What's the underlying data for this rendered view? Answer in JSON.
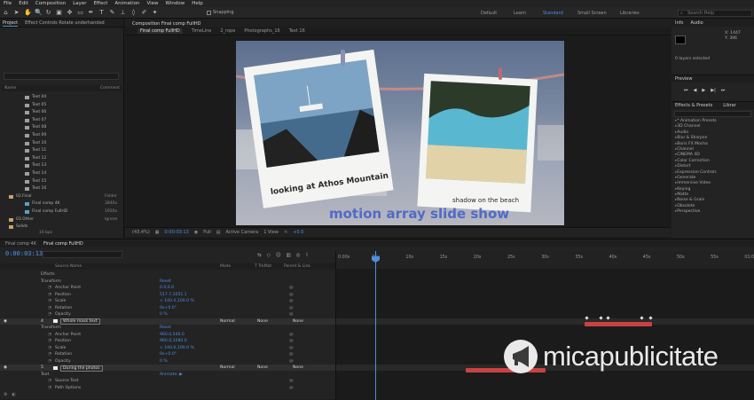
{
  "menu": [
    "File",
    "Edit",
    "Composition",
    "Layer",
    "Effect",
    "Animation",
    "View",
    "Window",
    "Help"
  ],
  "toolbar": {
    "snapping_label": "Snapping",
    "workspaces": [
      "Default",
      "Learn",
      "Standard",
      "Small Screen",
      "Libraries"
    ],
    "active_workspace": "Standard",
    "search_placeholder": "Search Help"
  },
  "project_panel": {
    "tabs": [
      "Project",
      "Effect Controls Rotate underhanded"
    ],
    "col_name": "Name",
    "col_comment": "Comment",
    "items": [
      {
        "name": "Text 04",
        "type": ""
      },
      {
        "name": "Text 05",
        "type": ""
      },
      {
        "name": "Text 06",
        "type": ""
      },
      {
        "name": "Text 07",
        "type": ""
      },
      {
        "name": "Text 08",
        "type": ""
      },
      {
        "name": "Text 09",
        "type": ""
      },
      {
        "name": "Text 10",
        "type": ""
      },
      {
        "name": "Text 11",
        "type": ""
      },
      {
        "name": "Text 12",
        "type": ""
      },
      {
        "name": "Text 13",
        "type": ""
      },
      {
        "name": "Text 14",
        "type": ""
      },
      {
        "name": "Text 15",
        "type": ""
      },
      {
        "name": "Text 16",
        "type": ""
      },
      {
        "name": "02.Final",
        "type": "Folder"
      },
      {
        "name": "Final comp 4K",
        "type": "3840x"
      },
      {
        "name": "Final comp FullHD",
        "type": "1920x"
      },
      {
        "name": "03.Other",
        "type": "Ignore"
      },
      {
        "name": "Solids",
        "type": ""
      }
    ],
    "footer_bpc": "16 bpc"
  },
  "composition": {
    "tab": "Composition Final comp FullHD",
    "breadcrumbs": [
      "Final comp FullHD",
      "TimeLine",
      "2_rope",
      "Photographs_16",
      "Text 16"
    ],
    "canvas": {
      "caption_left": "looking at Athos Mountain",
      "caption_right": "shadow on the beach",
      "title_text": "motion array slide show"
    },
    "viewer_bar": {
      "zoom": "(43.4%)",
      "timecode": "0:00:03:13",
      "resolution": "Full",
      "camera": "Active Camera",
      "views": "1 View",
      "exposure": "+0.0"
    }
  },
  "right_panel": {
    "info_tabs": [
      "Info",
      "Audio"
    ],
    "info_values": [
      "X: 1447",
      "Y: 396"
    ],
    "layers_selected": "0 layers selected",
    "preview_label": "Preview",
    "effects_label": "Effects & Presets",
    "effects_tab2": "Librar",
    "effects_search": "",
    "effects": [
      "* Animation Presets",
      "3D Channel",
      "Audio",
      "Blur & Sharpen",
      "Boris FX Mocha",
      "Channel",
      "CINEMA 4D",
      "Color Correction",
      "Distort",
      "Expression Controls",
      "Generate",
      "Immersive Video",
      "Keying",
      "Matte",
      "Noise & Grain",
      "Obsolete",
      "Perspective"
    ]
  },
  "timeline": {
    "tabs": [
      "Final comp 4K",
      "Final comp FullHD"
    ],
    "active_tab": "Final comp FullHD",
    "timecode": "0:00:03:13",
    "columns": [
      "Source Name",
      "Mode",
      "T TrkMat",
      "Parent & Link"
    ],
    "rows": [
      {
        "kind": "prop",
        "indent": 2,
        "label": "Effects",
        "value": ""
      },
      {
        "kind": "prop",
        "indent": 2,
        "label": "Transform",
        "value": "Reset"
      },
      {
        "kind": "prop",
        "indent": 3,
        "label": "Anchor Point",
        "value": "0.0,0.0"
      },
      {
        "kind": "prop",
        "indent": 3,
        "label": "Position",
        "value": "517.7,1051.1"
      },
      {
        "kind": "prop",
        "indent": 3,
        "label": "Scale",
        "value": "∞ 100.0,100.0 %"
      },
      {
        "kind": "prop",
        "indent": 3,
        "label": "Rotation",
        "value": "0x+0.0°"
      },
      {
        "kind": "prop",
        "indent": 3,
        "label": "Opacity",
        "value": "0 %"
      },
      {
        "kind": "layer",
        "index": "4",
        "label": "Whole mask text",
        "mode": "Normal",
        "trkmat": "None",
        "parent": "None"
      },
      {
        "kind": "prop",
        "indent": 2,
        "label": "Transform",
        "value": "Reset"
      },
      {
        "kind": "prop",
        "indent": 3,
        "label": "Anchor Point",
        "value": "960.0,540.0"
      },
      {
        "kind": "prop",
        "indent": 3,
        "label": "Position",
        "value": "960.0,1080.0"
      },
      {
        "kind": "prop",
        "indent": 3,
        "label": "Scale",
        "value": "∞ 100.0,100.0 %"
      },
      {
        "kind": "prop",
        "indent": 3,
        "label": "Rotation",
        "value": "0x+0.0°"
      },
      {
        "kind": "prop",
        "indent": 3,
        "label": "Opacity",
        "value": "0 %"
      },
      {
        "kind": "layer",
        "index": "5",
        "label": "During the photos",
        "mode": "Normal",
        "trkmat": "None",
        "parent": "None"
      },
      {
        "kind": "prop",
        "indent": 2,
        "label": "Text",
        "value": "Animate: ▶"
      },
      {
        "kind": "prop",
        "indent": 3,
        "label": "Source Text",
        "value": ""
      },
      {
        "kind": "prop",
        "indent": 3,
        "label": "Path Options",
        "value": ""
      }
    ],
    "ruler_ticks": [
      "0:00s",
      "05s",
      "10s",
      "15s",
      "20s",
      "25s",
      "30s",
      "35s",
      "40s",
      "45s",
      "50s",
      "55s",
      "01:0"
    ]
  },
  "watermark": {
    "text": "micapublicitate"
  },
  "colors": {
    "accent_blue": "#4f8ee0",
    "layer_bar_red": "#c94242",
    "panel_bg": "#232323"
  }
}
